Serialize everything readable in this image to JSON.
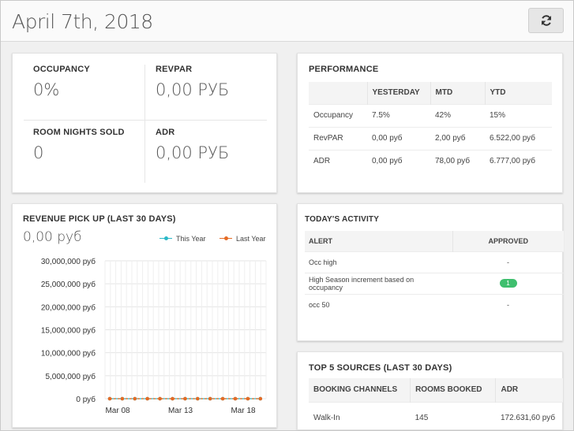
{
  "header": {
    "title": "April 7th, 2018",
    "refresh_icon": "refresh-icon"
  },
  "kpis": {
    "occupancy": {
      "label": "OCCUPANCY",
      "value": "0%"
    },
    "revpar": {
      "label": "REVPAR",
      "value": "0,00 РУБ"
    },
    "room_nights": {
      "label": "ROOM NIGHTS SOLD",
      "value": "0"
    },
    "adr": {
      "label": "ADR",
      "value": "0,00 РУБ"
    }
  },
  "performance": {
    "title": "PERFORMANCE",
    "columns": [
      "",
      "YESTERDAY",
      "MTD",
      "YTD"
    ],
    "rows": [
      [
        "Occupancy",
        "7.5%",
        "42%",
        "15%"
      ],
      [
        "RevPAR",
        "0,00 руб",
        "2,00 руб",
        "6.522,00 руб"
      ],
      [
        "ADR",
        "0,00 руб",
        "78,00 руб",
        "6.777,00 руб"
      ]
    ]
  },
  "revenue": {
    "title": "REVENUE PICK UP (LAST 30 DAYS)",
    "total": "0,00 руб",
    "legend": {
      "this_year": "This Year",
      "last_year": "Last Year"
    }
  },
  "activity": {
    "title": "TODAY'S ACTIVITY",
    "columns": [
      "ALERT",
      "APPROVED"
    ],
    "rows": [
      {
        "alert": "Occ high",
        "approved": "-"
      },
      {
        "alert": "High Season increment based on occupancy",
        "approved": "1",
        "badge": true
      },
      {
        "alert": "occ 50",
        "approved": "-"
      }
    ]
  },
  "sources": {
    "title": "TOP 5 SOURCES (LAST 30 DAYS)",
    "columns": [
      "BOOKING CHANNELS",
      "ROOMS BOOKED",
      "ADR"
    ],
    "rows": [
      [
        "Walk-In",
        "145",
        "172.631,60 руб"
      ]
    ]
  },
  "colors": {
    "this_year": "#2ab8c7",
    "last_year": "#e56b25",
    "badge": "#3fbf6e"
  },
  "chart_data": {
    "type": "line",
    "title": "",
    "xlabel": "",
    "ylabel": "",
    "ylim": [
      0,
      30000000
    ],
    "yticks": [
      "30,000,000 руб",
      "25,000,000 руб",
      "20,000,000 руб",
      "15,000,000 руб",
      "10,000,000 руб",
      "5,000,000 руб",
      "0 руб"
    ],
    "xticks": [
      "Mar 08",
      "Mar 13",
      "Mar 18"
    ],
    "x": [
      "Mar 08",
      "Mar 09",
      "Mar 10",
      "Mar 11",
      "Mar 12",
      "Mar 13",
      "Mar 14",
      "Mar 15",
      "Mar 16",
      "Mar 17",
      "Mar 18",
      "Mar 19",
      "Mar 20"
    ],
    "series": [
      {
        "name": "This Year",
        "values": [
          0,
          0,
          0,
          0,
          0,
          0,
          0,
          0,
          0,
          0,
          0,
          0,
          0
        ]
      },
      {
        "name": "Last Year",
        "values": [
          0,
          0,
          0,
          0,
          0,
          0,
          0,
          0,
          0,
          0,
          0,
          0,
          0
        ]
      }
    ],
    "grid": true,
    "legend_position": "top-right"
  }
}
